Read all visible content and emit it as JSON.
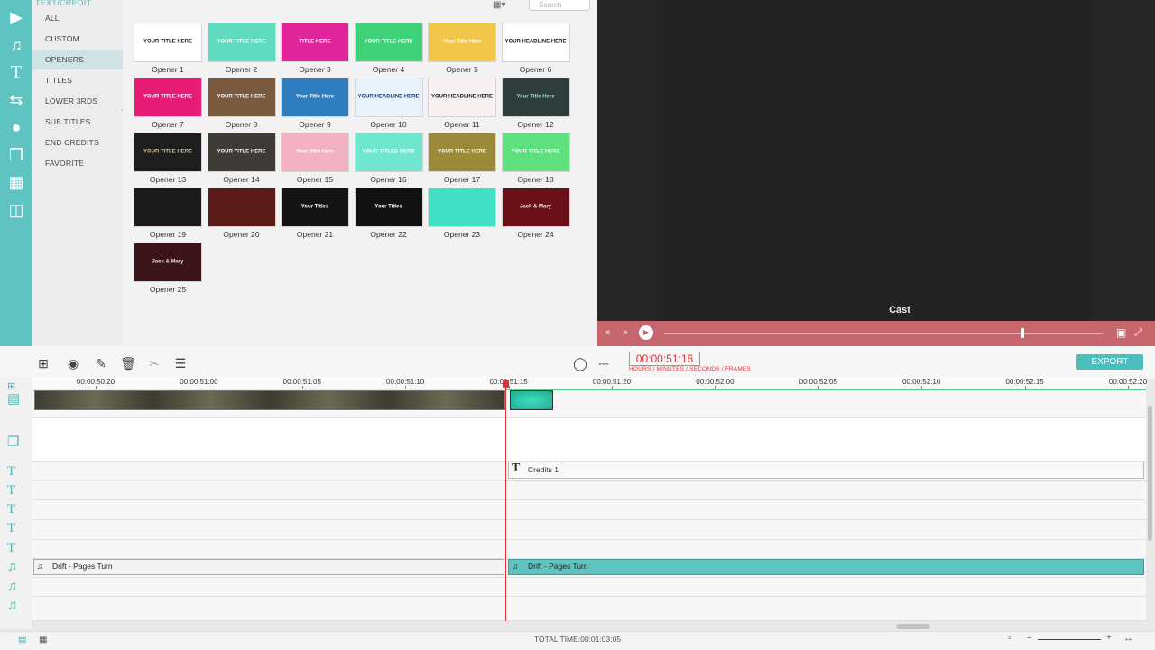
{
  "sidebar": {
    "header": "TEXT/CREDIT",
    "categories": [
      {
        "label": "ALL"
      },
      {
        "label": "CUSTOM"
      },
      {
        "label": "OPENERS",
        "active": true
      },
      {
        "label": "TITLES"
      },
      {
        "label": "LOWER 3RDS"
      },
      {
        "label": "SUB TITLES"
      },
      {
        "label": "END CREDITS"
      },
      {
        "label": "FAVORITE"
      }
    ]
  },
  "gallery": {
    "search_placeholder": "Search",
    "items": [
      {
        "label": "Opener 1",
        "text": "YOUR TITLE HERE",
        "bg": "#ffffff",
        "fg": "#222222"
      },
      {
        "label": "Opener 2",
        "text": "YOUR TITLE HERE",
        "bg": "#5fdcc0",
        "fg": "#ffffff"
      },
      {
        "label": "Opener 3",
        "text": "TITLE HERE",
        "bg": "#e0249a",
        "fg": "#ffffff"
      },
      {
        "label": "Opener 4",
        "text": "YOUR TITLE HERE",
        "bg": "#3fd27a",
        "fg": "#ffffff"
      },
      {
        "label": "Opener 5",
        "text": "Your Title Here",
        "bg": "#f3c84a",
        "fg": "#ffffff"
      },
      {
        "label": "Opener 6",
        "text": "YOUR HEADLINE HERE",
        "bg": "#ffffff",
        "fg": "#111111"
      },
      {
        "label": "Opener 7",
        "text": "YOUR TITLE HERE",
        "bg": "#e61b76",
        "fg": "#ffffff"
      },
      {
        "label": "Opener 8",
        "text": "YOUR TITLE HERE",
        "bg": "#7a5a3e",
        "fg": "#ffffff"
      },
      {
        "label": "Opener 9",
        "text": "Your Title Here",
        "bg": "#2f7ec0",
        "fg": "#ffffff"
      },
      {
        "label": "Opener 10",
        "text": "YOUR HEADLINE HERE",
        "bg": "#e8f2fb",
        "fg": "#1b3c6a"
      },
      {
        "label": "Opener 11",
        "text": "YOUR HEADLINE HERE",
        "bg": "#f8f1f1",
        "fg": "#1b1b1b"
      },
      {
        "label": "Opener 12",
        "text": "Your Title Here",
        "bg": "#2e3c3c",
        "fg": "#9fe0d0"
      },
      {
        "label": "Opener 13",
        "text": "YOUR TITLE HERE",
        "bg": "#1e1e1e",
        "fg": "#d9c48c"
      },
      {
        "label": "Opener 14",
        "text": "YOUR TITLE HERE",
        "bg": "#3e3a36",
        "fg": "#ffffff"
      },
      {
        "label": "Opener 15",
        "text": "Your Title Here",
        "bg": "#f3b1c4",
        "fg": "#ffffff"
      },
      {
        "label": "Opener 16",
        "text": "YOUR TITLES HERE",
        "bg": "#6fe6cf",
        "fg": "#ffffff"
      },
      {
        "label": "Opener 17",
        "text": "YOUR TITLE HERE",
        "bg": "#9a8a3a",
        "fg": "#ffffff"
      },
      {
        "label": "Opener 18",
        "text": "YOUR TITLE HERE",
        "bg": "#5ee07e",
        "fg": "#ffffff"
      },
      {
        "label": "Opener 19",
        "text": "",
        "bg": "#1a1a1a",
        "fg": "#ffffff"
      },
      {
        "label": "Opener 20",
        "text": "",
        "bg": "#5a1a18",
        "fg": "#ffffff"
      },
      {
        "label": "Opener 21",
        "text": "Your Titles",
        "bg": "#141414",
        "fg": "#ffffff"
      },
      {
        "label": "Opener 22",
        "text": "Your Titles",
        "bg": "#121212",
        "fg": "#ffffff"
      },
      {
        "label": "Opener 23",
        "text": "",
        "bg": "#3fe0c3",
        "fg": "#ffffff"
      },
      {
        "label": "Opener 24",
        "text": "Jack & Mary",
        "bg": "#6a1018",
        "fg": "#f4dede"
      },
      {
        "label": "Opener 25",
        "text": "Jack & Mary",
        "bg": "#3a1418",
        "fg": "#f4dede"
      }
    ]
  },
  "preview": {
    "caption": "Cast",
    "progress": 0.815
  },
  "toolbar": {
    "timecode": "00:00:51:16",
    "timecode_hint": "HOURS / MINUTES / SECONDS / FRAMES",
    "export_label": "EXPORT"
  },
  "timeline": {
    "ruler_labels": [
      "00:00:50:20",
      "00:00:51:00",
      "00:00:51:05",
      "00:00:51:10",
      "00:00:51:15",
      "00:00:51:20",
      "00:00:52:00",
      "00:00:52:05",
      "00:00:52:10",
      "00:00:52:15",
      "00:00:52:20"
    ],
    "credits_clip": "Credits 1",
    "audio_clip_1": "Drift - Pages Turn",
    "audio_clip_2": "Drift - Pages Turn"
  },
  "status": {
    "total_time": "TOTAL TIME:00:01:03:05"
  },
  "colors": {
    "accent": "#5fc3c1",
    "playhead": "#e0323c",
    "player_bar": "#c8666e"
  }
}
